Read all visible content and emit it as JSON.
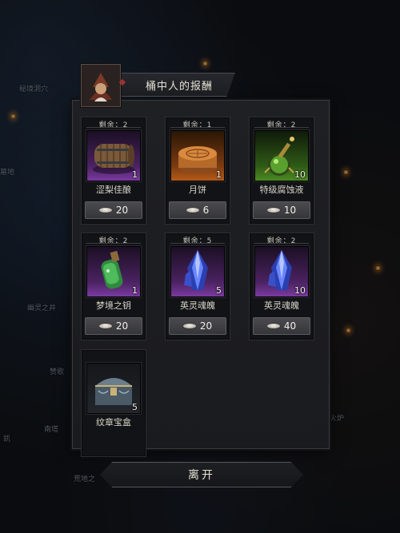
{
  "background_map": {
    "labels": [
      "秘境洞穴",
      "墓地",
      "幽灵之井",
      "赞歌",
      "南塔",
      "凯",
      "火炉",
      "荒地之"
    ]
  },
  "dialog": {
    "title": "桶中人的报酬",
    "items": [
      {
        "remain_label": "剩余：2",
        "name": "涩梨佳酿",
        "quantity": "1",
        "price": "20",
        "rarity": "purple",
        "icon": "barrel-icon"
      },
      {
        "remain_label": "剩余：1",
        "name": "月饼",
        "quantity": "1",
        "price": "6",
        "rarity": "orange",
        "icon": "mooncake-icon"
      },
      {
        "remain_label": "剩余：2",
        "name": "特级腐蚀液",
        "quantity": "10",
        "price": "10",
        "rarity": "green",
        "icon": "potion-bottle-icon"
      },
      {
        "remain_label": "剩余：2",
        "name": "梦境之钥",
        "quantity": "1",
        "price": "20",
        "rarity": "purple",
        "icon": "green-vial-icon"
      },
      {
        "remain_label": "剩余：5",
        "name": "英灵魂魄",
        "quantity": "5",
        "price": "20",
        "rarity": "purple",
        "icon": "blue-crystal-icon"
      },
      {
        "remain_label": "剩余：2",
        "name": "英灵魂魄",
        "quantity": "10",
        "price": "40",
        "rarity": "purple",
        "icon": "blue-crystal-icon"
      },
      {
        "remain_label": "",
        "name": "纹章宝盒",
        "quantity": "5",
        "price": "",
        "rarity": "plain",
        "icon": "treasure-chest-icon"
      }
    ],
    "leave_label": "离开"
  },
  "colors": {
    "panel_bg": "#1c1d20",
    "purple": "#7a3aa0",
    "orange": "#b55a18",
    "green": "#4c8a22"
  }
}
